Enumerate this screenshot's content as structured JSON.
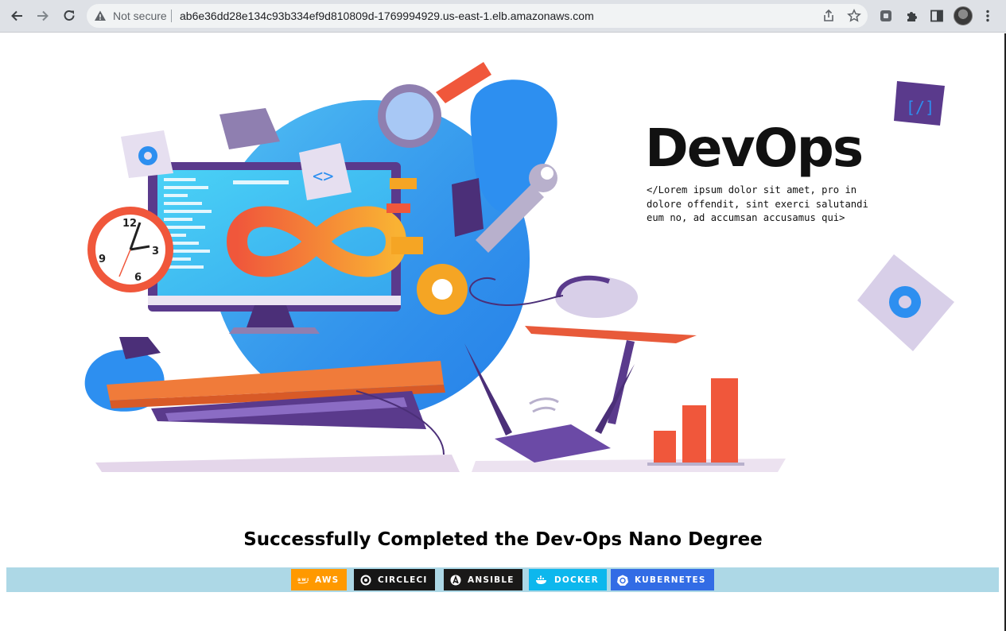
{
  "browser": {
    "security_label": "Not secure",
    "url": "ab6e36dd28e134c93b334ef9d810809d-1769994929.us-east-1.elb.amazonaws.com",
    "icons": [
      "back-icon",
      "forward-icon",
      "reload-icon",
      "warning-icon",
      "share-icon",
      "star-icon",
      "extension-icon",
      "puzzle-icon",
      "sidepanel-icon",
      "avatar",
      "menu-icon"
    ]
  },
  "hero": {
    "brand_title": "DevOps",
    "brand_text": "</Lorem ipsum dolor sit amet, pro in dolore offendit, sint exerci salutandi eum no, ad accumsan accusamus qui>",
    "clock_numbers": [
      "12",
      "3",
      "6",
      "9"
    ],
    "colors": {
      "blue_blob": "#2d8ff0",
      "orange": "#f07b3a",
      "purple": "#5a3a8c",
      "screen": "#4cc6f2"
    }
  },
  "headline": "Successfully Completed the Dev-Ops Nano Degree",
  "badges": [
    {
      "label": "AWS",
      "icon": "aws-icon",
      "color": "#ff9900"
    },
    {
      "label": "CIRCLECI",
      "icon": "circleci-icon",
      "color": "#161616"
    },
    {
      "label": "ANSIBLE",
      "icon": "ansible-icon",
      "color": "#1a1918"
    },
    {
      "label": "DOCKER",
      "icon": "docker-icon",
      "color": "#0db7ed"
    },
    {
      "label": "KUBERNETES",
      "icon": "kubernetes-icon",
      "color": "#326ce5"
    }
  ]
}
